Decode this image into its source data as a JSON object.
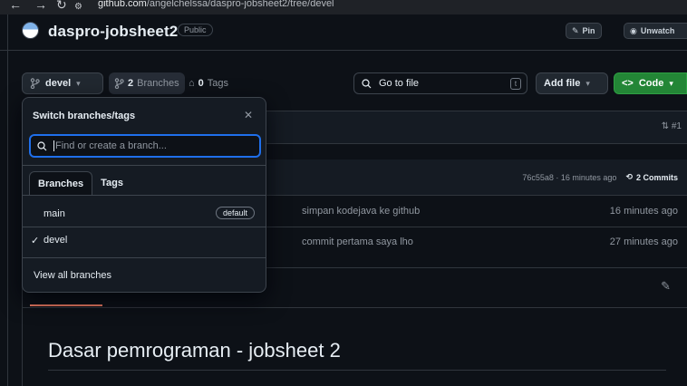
{
  "browser": {
    "url_host": "github.com",
    "url_path": "/angelchelssa/daspro-jobsheet2/tree/devel"
  },
  "repo": {
    "name": "daspro-jobsheet2",
    "visibility": "Public",
    "pin_label": "Pin",
    "unwatch_label": "Unwatch"
  },
  "toolbar": {
    "branch": "devel",
    "branches_count": "2",
    "branches_label": "Branches",
    "tags_count": "0",
    "tags_label": "Tags",
    "goto_placeholder": "Go to file",
    "goto_shortcut": "t",
    "add_file_label": "Add file",
    "code_label": "Code"
  },
  "commit_bar": {
    "pr_count": "#1",
    "meta": "76c55a8 · 16 minutes ago",
    "commits_label": "2 Commits"
  },
  "files": [
    {
      "message": "simpan kodejava ke github",
      "time": "16 minutes ago"
    },
    {
      "message": "commit pertama saya lho",
      "time": "27 minutes ago"
    }
  ],
  "readme": {
    "title": "Dasar pemrograman - jobsheet 2"
  },
  "dropdown": {
    "title": "Switch branches/tags",
    "search_placeholder": "Find or create a branch...",
    "tabs": [
      "Branches",
      "Tags"
    ],
    "branches": [
      {
        "name": "main",
        "badge": "default",
        "checked": false
      },
      {
        "name": "devel",
        "badge": "",
        "checked": true
      }
    ],
    "footer_link": "View all branches"
  }
}
